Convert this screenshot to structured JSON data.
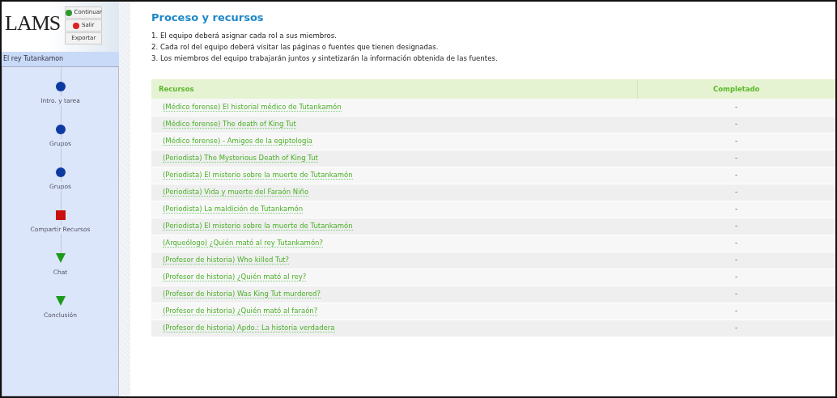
{
  "logo": "LAMS",
  "buttons": [
    {
      "label": "Continuar",
      "kind": "go"
    },
    {
      "label": "Salir",
      "kind": "stop"
    },
    {
      "label": "Exportar",
      "kind": "plain"
    }
  ],
  "lesson_title": "El rey Tutankamon",
  "activities": [
    {
      "label": "Intro. y tarea",
      "kind": "done"
    },
    {
      "label": "Grupos",
      "kind": "done"
    },
    {
      "label": "Grupos",
      "kind": "done"
    },
    {
      "label": "Compartir Recursos",
      "kind": "current"
    },
    {
      "label": "Chat",
      "kind": "todo"
    },
    {
      "label": "Conclusión",
      "kind": "todo"
    }
  ],
  "heading": "Proceso y recursos",
  "instructions": [
    "1. El equipo deberá asignar cada rol a sus miembros.",
    "2. Cada rol del equipo deberá visitar las páginas o fuentes que tienen designadas.",
    "3. Los miembros del equipo trabajarán juntos y sintetizarán la información obtenida de las fuentes."
  ],
  "table": {
    "columns": [
      "Recursos",
      "Completado"
    ],
    "rows": [
      {
        "resource": "(Médico forense) El historial médico de Tutankamón",
        "completed": "-"
      },
      {
        "resource": "(Médico forense) The death of King Tut",
        "completed": "-"
      },
      {
        "resource": "(Médico forense) - Amigos de la egiptología",
        "completed": "-"
      },
      {
        "resource": "(Periodista) The Mysterious Death of King Tut",
        "completed": "-"
      },
      {
        "resource": "(Periodista) El misterio sobre la muerte de Tutankamón",
        "completed": "-"
      },
      {
        "resource": "(Periodista) Vida y muerte del Faraón Niño",
        "completed": "-"
      },
      {
        "resource": "(Periodista) La maldición de Tutankamón",
        "completed": "-"
      },
      {
        "resource": "(Periodista) El misterio sobre la muerte de Tutankamón",
        "completed": "-"
      },
      {
        "resource": "(Arqueólogo) ¿Quién mató al rey Tutankamón?",
        "completed": "-"
      },
      {
        "resource": "(Profesor de historia) Who killed Tut?",
        "completed": "-"
      },
      {
        "resource": "(Profesor de historia) ¿Quién mató al rey?",
        "completed": "-"
      },
      {
        "resource": "(Profesor de historia) Was King Tut murdered?",
        "completed": "-"
      },
      {
        "resource": "(Profesor de historia) ¿Quién mató al faraón?",
        "completed": "-"
      },
      {
        "resource": "(Profesor de historia) Apdo.: La historia verdadera",
        "completed": "-"
      }
    ]
  }
}
